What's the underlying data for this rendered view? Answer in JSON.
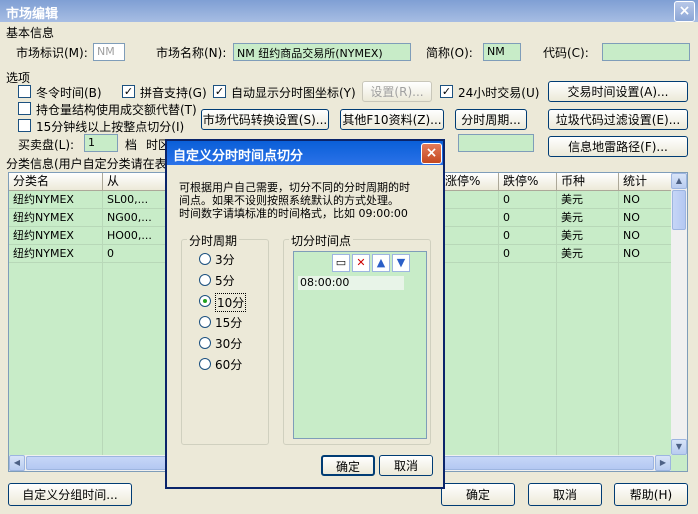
{
  "window": {
    "title": "市场编辑",
    "close": "×"
  },
  "basic": {
    "section": "基本信息",
    "market_id_label": "市场标识(M):",
    "market_id_value": "NM",
    "market_name_label": "市场名称(N):",
    "market_name_value": "NM 纽约商品交易所(NYMEX)",
    "short_label": "简称(O):",
    "short_value": "NM",
    "code_label": "代码(C):",
    "code_value": ""
  },
  "options": {
    "section": "选项",
    "winter_time": "冬令时间(B)",
    "pinyin": "拼音支持(G)",
    "auto_coord": "自动显示分时图坐标(Y)",
    "settings_btn": "设置(R)...",
    "h24": "24小时交易(U)",
    "trade_time_btn": "交易时间设置(A)...",
    "position_struct": "持仓量结构使用成交额代替(T)",
    "market_code_btn": "市场代码转换设置(S)...",
    "f10_btn": "其他F10资料(Z)...",
    "period_btn": "分时周期...",
    "junk_filter_btn": "垃圾代码过滤设置(E)...",
    "min15_split": "15分钟线以上按整点切分(I)",
    "buy_sell_label": "买卖盘(L):",
    "buy_sell_value": "1",
    "gear_label": "档",
    "tz_label": "时区",
    "mine_path_btn": "信息地雷路径(F)..."
  },
  "category_hint": "分类信息(用户自定分类请在表",
  "table": {
    "headers": [
      "分类名",
      "从",
      "涨停%",
      "跌停%",
      "币种",
      "统计"
    ],
    "rows": [
      [
        "纽约NYMEX",
        "SL00,...",
        "",
        "0",
        "美元",
        "NO"
      ],
      [
        "纽约NYMEX",
        "NG00,...",
        "",
        "0",
        "美元",
        "NO"
      ],
      [
        "纽约NYMEX",
        "HO00,...",
        "",
        "0",
        "美元",
        "NO"
      ],
      [
        "纽约NYMEX",
        "0",
        "",
        "0",
        "美元",
        "NO"
      ]
    ]
  },
  "footer": {
    "custom_group_btn": "自定义分组时间...",
    "ok_btn": "确定",
    "cancel_btn": "取消",
    "help_btn": "帮助(H)"
  },
  "dialog": {
    "title": "自定义分时时间点切分",
    "close": "×",
    "desc1": "可根据用户自己需要，切分不同的分时周期的时",
    "desc2": "间点。如果不设则按照系统默认的方式处理。",
    "desc3": "时间数字请填标准的时间格式，比如 09:00:00",
    "period_group": "分时周期",
    "periods": [
      "3分",
      "5分",
      "10分",
      "15分",
      "30分",
      "60分"
    ],
    "selected_period": "10分",
    "split_group": "切分时间点",
    "time_points": [
      "08:00:00"
    ],
    "ok_btn": "确定",
    "cancel_btn": "取消"
  },
  "colors": {
    "accent": "#0a5fd8",
    "grid_bg": "#c8ecc8",
    "window_bg": "#ece9d8"
  }
}
